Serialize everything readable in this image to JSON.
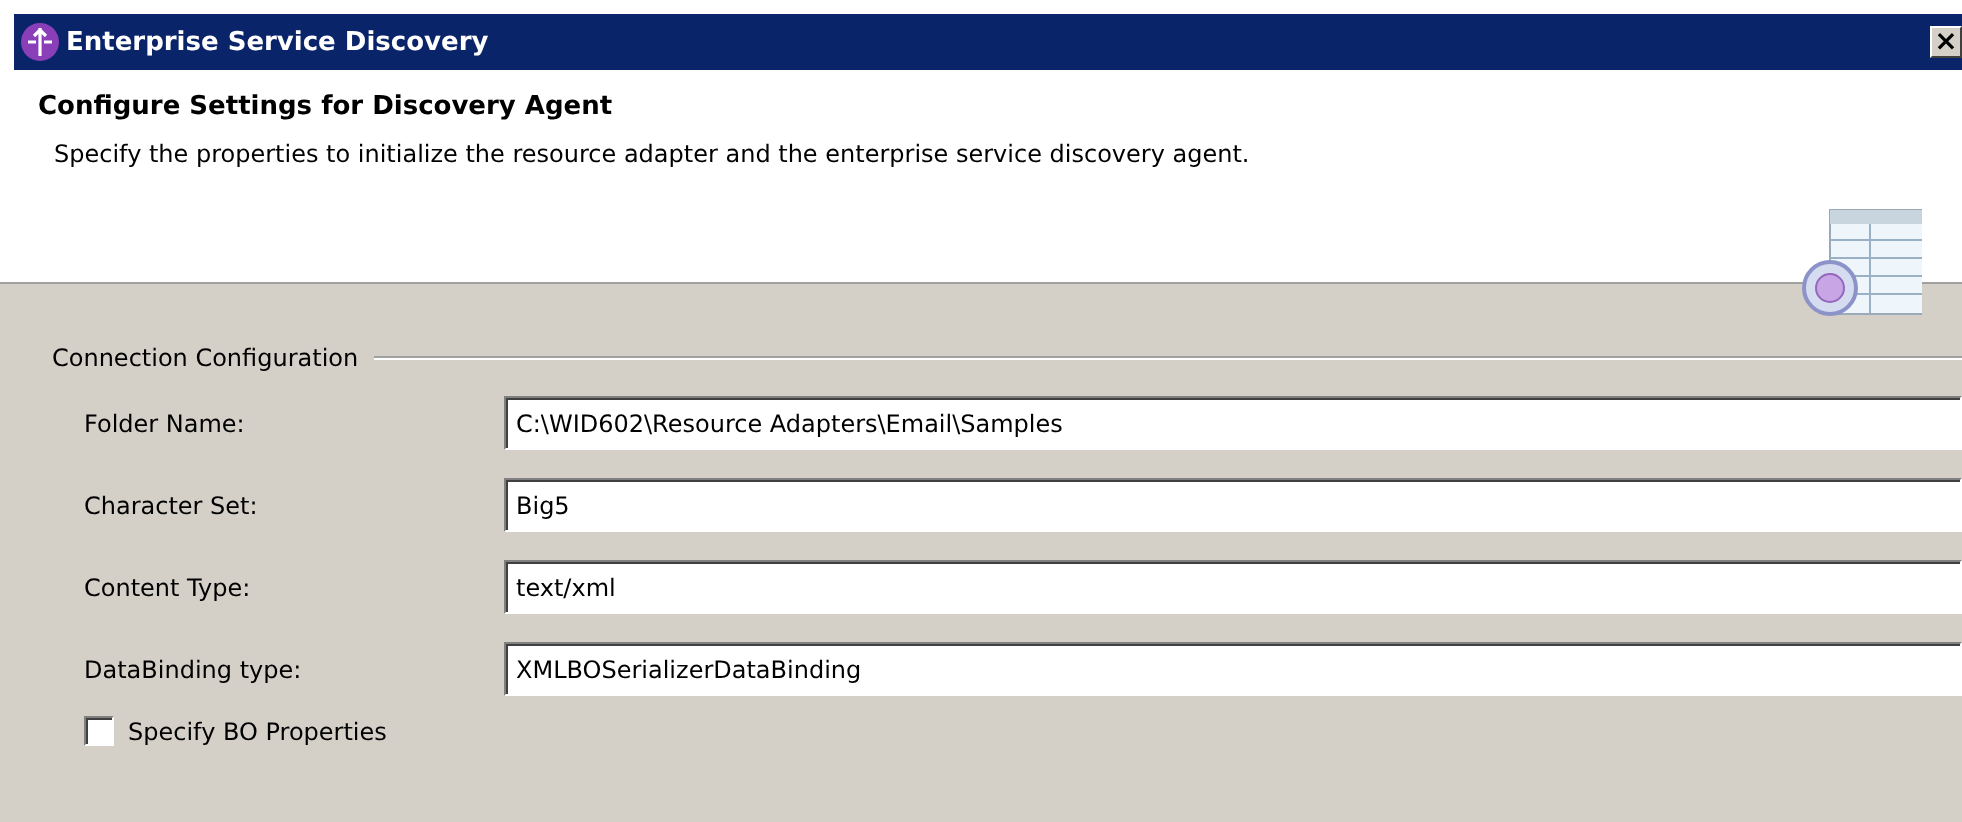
{
  "window": {
    "title": "Enterprise Service Discovery",
    "close": "×"
  },
  "header": {
    "title": "Configure Settings for Discovery Agent",
    "description": "Specify the properties to initialize the resource adapter and the enterprise service discovery agent."
  },
  "group": {
    "label": "Connection Configuration",
    "fields": [
      {
        "label": "Folder Name:",
        "value": "C:\\WID602\\Resource Adapters\\Email\\Samples"
      },
      {
        "label": "Character Set:",
        "value": "Big5"
      },
      {
        "label": "Content Type:",
        "value": "text/xml"
      },
      {
        "label": "DataBinding type:",
        "value": "XMLBOSerializerDataBinding"
      }
    ],
    "checkbox": {
      "label": "Specify BO Properties",
      "checked": false
    }
  }
}
